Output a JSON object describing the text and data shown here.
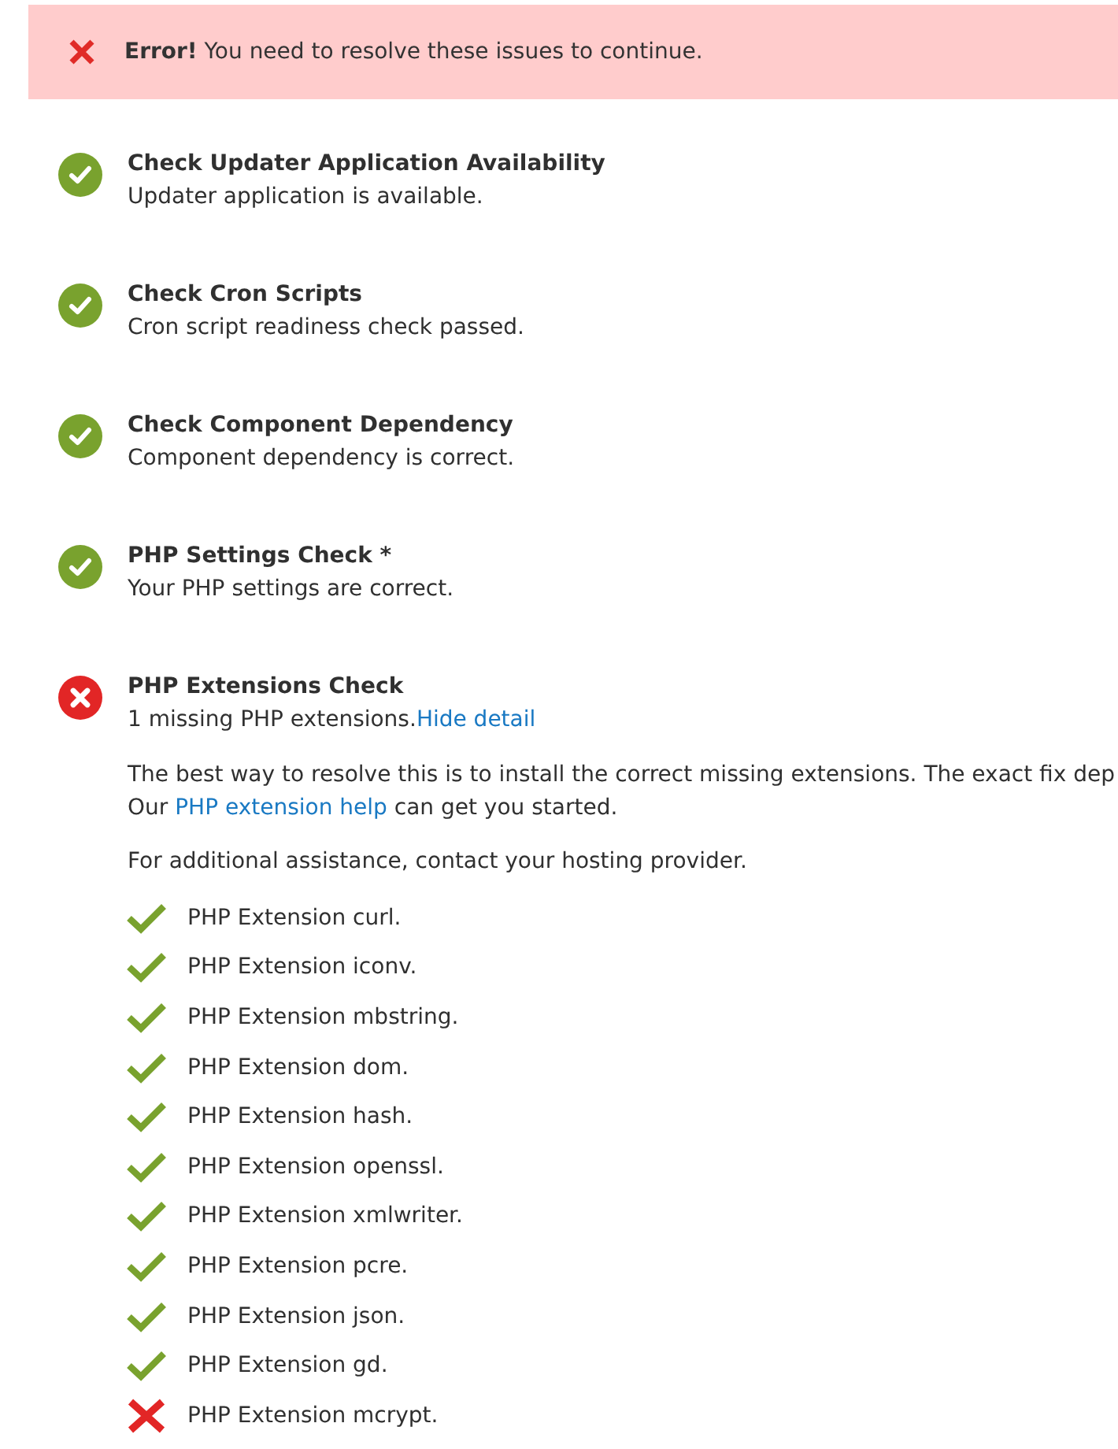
{
  "alert": {
    "message": "**Error!** You need to resolve these issues to continue."
  },
  "checks": [
    {
      "passed": true,
      "title": "Check Updater Application Availability",
      "description": "Updater application is available."
    },
    {
      "passed": true,
      "title": "Check Cron Scripts",
      "description": "Cron script readiness check passed."
    },
    {
      "passed": true,
      "title": "Check Component Dependency",
      "description": "Component dependency is correct."
    },
    {
      "passed": true,
      "title": "PHP Settings Check *",
      "description": "Your PHP settings are correct."
    },
    {
      "passed": false,
      "title": "PHP Extensions Check",
      "description": "1 missing PHP extensions.",
      "detail_link": "Hide detail",
      "detail": {
        "help_text": "The best way to resolve this is to install the correct missing extensions. The exact fix dep",
        "help_prefix": "Our",
        "help_link": "PHP extension help",
        "help_suffix": "can get you started.",
        "note": "For additional assistance, contact your hosting provider.",
        "extensions": [
          {
            "label": "PHP Extension curl.",
            "installed": true
          },
          {
            "label": "PHP Extension iconv.",
            "installed": true
          },
          {
            "label": "PHP Extension mbstring.",
            "installed": true
          },
          {
            "label": "PHP Extension dom.",
            "installed": true
          },
          {
            "label": "PHP Extension hash.",
            "installed": true
          },
          {
            "label": "PHP Extension openssl.",
            "installed": true
          },
          {
            "label": "PHP Extension xmlwriter.",
            "installed": true
          },
          {
            "label": "PHP Extension pcre.",
            "installed": true
          },
          {
            "label": "PHP Extension json.",
            "installed": true
          },
          {
            "label": "PHP Extension gd.",
            "installed": true
          },
          {
            "label": "PHP Extension mcrypt.",
            "installed": false
          }
        ]
      }
    }
  ]
}
